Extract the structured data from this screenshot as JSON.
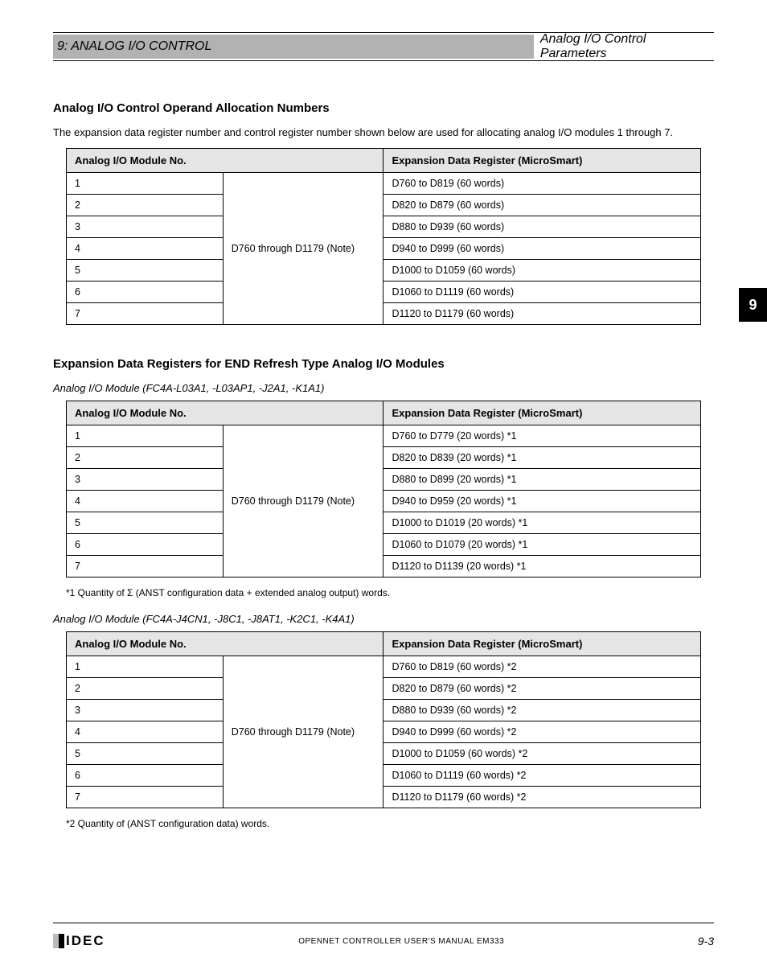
{
  "side_tab": "9",
  "header": {
    "band": "9: ANALOG I/O CONTROL",
    "right": "Analog I/O Control Parameters"
  },
  "section_title": "Analog I/O Control Operand Allocation Numbers",
  "section_sub": "The expansion data register number and control register number shown below are used for allocating analog I/O modules 1 through 7.",
  "table1": {
    "headers": [
      "Analog I/O Module No.",
      "Expansion Data Register (MicroSmart)"
    ],
    "rows": [
      [
        "1",
        "D760 to D819 (60 words)"
      ],
      [
        "2",
        "D820 to D879 (60 words)"
      ],
      [
        "3",
        "D880 to D939 (60 words)"
      ],
      [
        "4",
        "D940 to D999 (60 words)"
      ],
      [
        "5",
        "D1000 to D1059 (60 words)"
      ],
      [
        "6",
        "D1060 to D1119 (60 words)"
      ],
      [
        "7",
        "D1120 to D1179 (60 words)"
      ]
    ],
    "merged_col": "D760 through D1179 (Note)"
  },
  "mid_title": "Expansion Data Registers for END Refresh Type Analog I/O Modules",
  "mid_sub": "Analog I/O Module (FC4A-L03A1, -L03AP1, -J2A1, -K1A1)",
  "table2": {
    "headers": [
      "Analog I/O Module No.",
      "Expansion Data Register (MicroSmart)"
    ],
    "rows": [
      [
        "1",
        "D760 to D779 (20 words) *1"
      ],
      [
        "2",
        "D820 to D839 (20 words) *1"
      ],
      [
        "3",
        "D880 to D899 (20 words) *1"
      ],
      [
        "4",
        "D940 to D959 (20 words) *1"
      ],
      [
        "5",
        "D1000 to D1019 (20 words) *1"
      ],
      [
        "6",
        "D1060 to D1079 (20 words) *1"
      ],
      [
        "7",
        "D1120 to D1139 (20 words) *1"
      ]
    ],
    "merged_col": "D760 through D1179 (Note)"
  },
  "footnote1": "*1   Quantity of Σ (ANST configuration data + extended analog output) words.",
  "sub2": "Analog I/O Module (FC4A-J4CN1, -J8C1, -J8AT1, -K2C1, -K4A1)",
  "table3": {
    "headers": [
      "Analog I/O Module No.",
      "Expansion Data Register (MicroSmart)"
    ],
    "rows": [
      [
        "1",
        "D760 to D819 (60 words) *2"
      ],
      [
        "2",
        "D820 to D879 (60 words) *2"
      ],
      [
        "3",
        "D880 to D939 (60 words) *2"
      ],
      [
        "4",
        "D940 to D999 (60 words) *2"
      ],
      [
        "5",
        "D1000 to D1059 (60 words) *2"
      ],
      [
        "6",
        "D1060 to D1119 (60 words) *2"
      ],
      [
        "7",
        "D1120 to D1179 (60 words) *2"
      ]
    ],
    "merged_col": "D760 through D1179 (Note)"
  },
  "footnote2": "*2   Quantity of (ANST configuration data) words.",
  "footer": {
    "center": "OPENNET CONTROLLER USER'S MANUAL EM333",
    "right": "9-3"
  }
}
